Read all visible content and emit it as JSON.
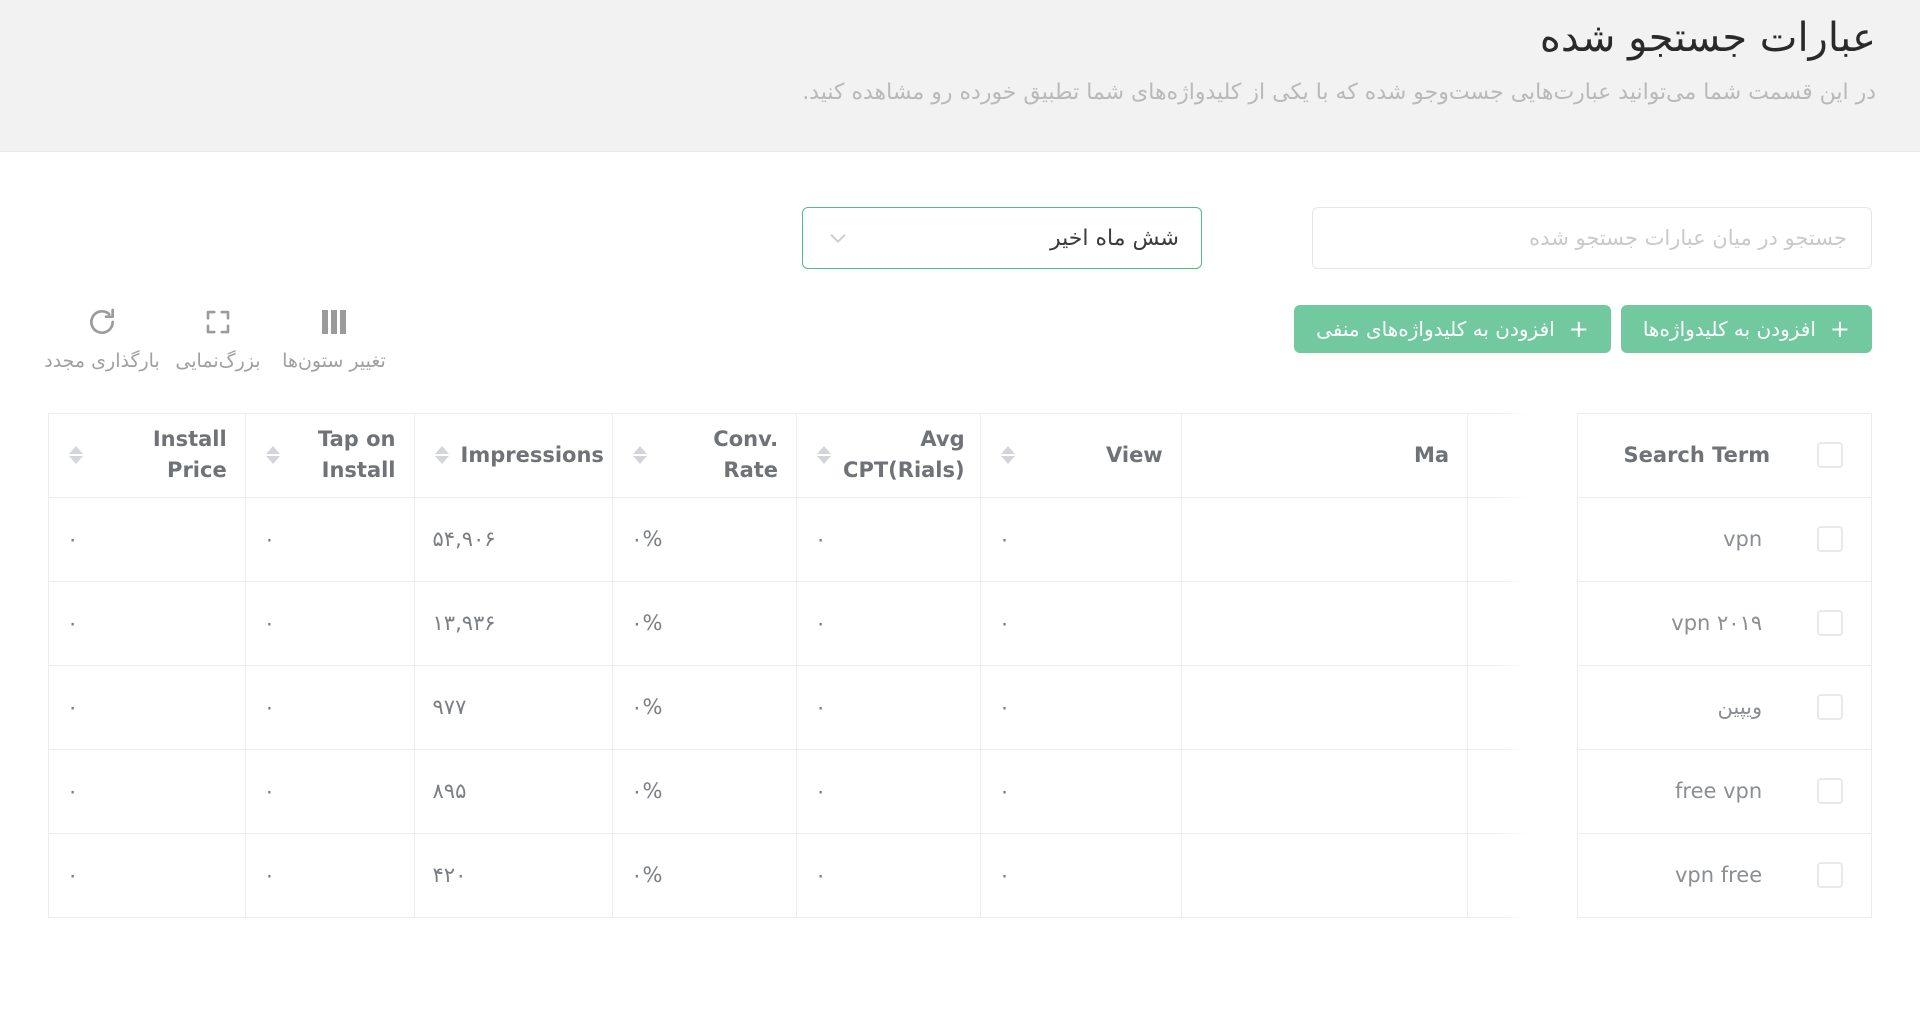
{
  "header": {
    "title": "عبارات جستجو شده",
    "subtitle": "در این قسمت شما می‌توانید عبارت‌هایی جست‌وجو شده که با یکی از کلیدواژه‌های شما تطبیق خورده رو مشاهده کنید."
  },
  "filters": {
    "search_placeholder": "جستجو در میان عبارات جستجو شده",
    "search_value": "",
    "date_range_value": "شش ماه اخیر",
    "chevron_icon": "chevron-down-icon"
  },
  "actions": {
    "add_keywords_label": "افزودن به کلیدواژه‌ها",
    "add_negative_keywords_label": "افزودن به کلیدواژه‌های منفی",
    "plus": "+",
    "accent_color": "#72c9a0",
    "border_accent_color": "#56b98c"
  },
  "tools": [
    {
      "label": "تغییر ستون‌ها",
      "icon": "columns-icon"
    },
    {
      "label": "بزرگ‌نمایی",
      "icon": "fullscreen-icon"
    },
    {
      "label": "بارگذاری مجدد",
      "icon": "refresh-icon"
    }
  ],
  "table": {
    "columns": [
      {
        "key": "check",
        "label": "",
        "sortable": false
      },
      {
        "key": "term",
        "label": "Search Term",
        "sortable": false
      },
      {
        "key": "match",
        "label": "Ma",
        "sortable": false
      },
      {
        "key": "view",
        "label": "View",
        "sortable": true
      },
      {
        "key": "cpt",
        "label": "Avg CPT(Rials)",
        "sortable": true
      },
      {
        "key": "conv",
        "label": "Conv. Rate",
        "sortable": true
      },
      {
        "key": "impr",
        "label": "Impressions",
        "sortable": true
      },
      {
        "key": "tap",
        "label": "Tap on Install",
        "sortable": true
      },
      {
        "key": "iprice",
        "label": "Install Price",
        "sortable": true
      }
    ],
    "select_all_checked": false,
    "rows": [
      {
        "term": "vpn",
        "match": "",
        "view": "۰",
        "cpt": "۰",
        "conv": "۰%",
        "impr": "۵۴,۹۰۶",
        "tap": "۰",
        "iprice": "۰",
        "checked": false
      },
      {
        "term": "vpn ۲۰۱۹",
        "match": "",
        "view": "۰",
        "cpt": "۰",
        "conv": "۰%",
        "impr": "۱۳,۹۳۶",
        "tap": "۰",
        "iprice": "۰",
        "checked": false
      },
      {
        "term": "ویپین",
        "match": "",
        "view": "۰",
        "cpt": "۰",
        "conv": "۰%",
        "impr": "۹۷۷",
        "tap": "۰",
        "iprice": "۰",
        "checked": false
      },
      {
        "term": "free vpn",
        "match": "",
        "view": "۰",
        "cpt": "۰",
        "conv": "۰%",
        "impr": "۸۹۵",
        "tap": "۰",
        "iprice": "۰",
        "checked": false
      },
      {
        "term": "vpn free",
        "match": "",
        "view": "۰",
        "cpt": "۰",
        "conv": "۰%",
        "impr": "۴۲۰",
        "tap": "۰",
        "iprice": "۰",
        "checked": false
      }
    ]
  }
}
